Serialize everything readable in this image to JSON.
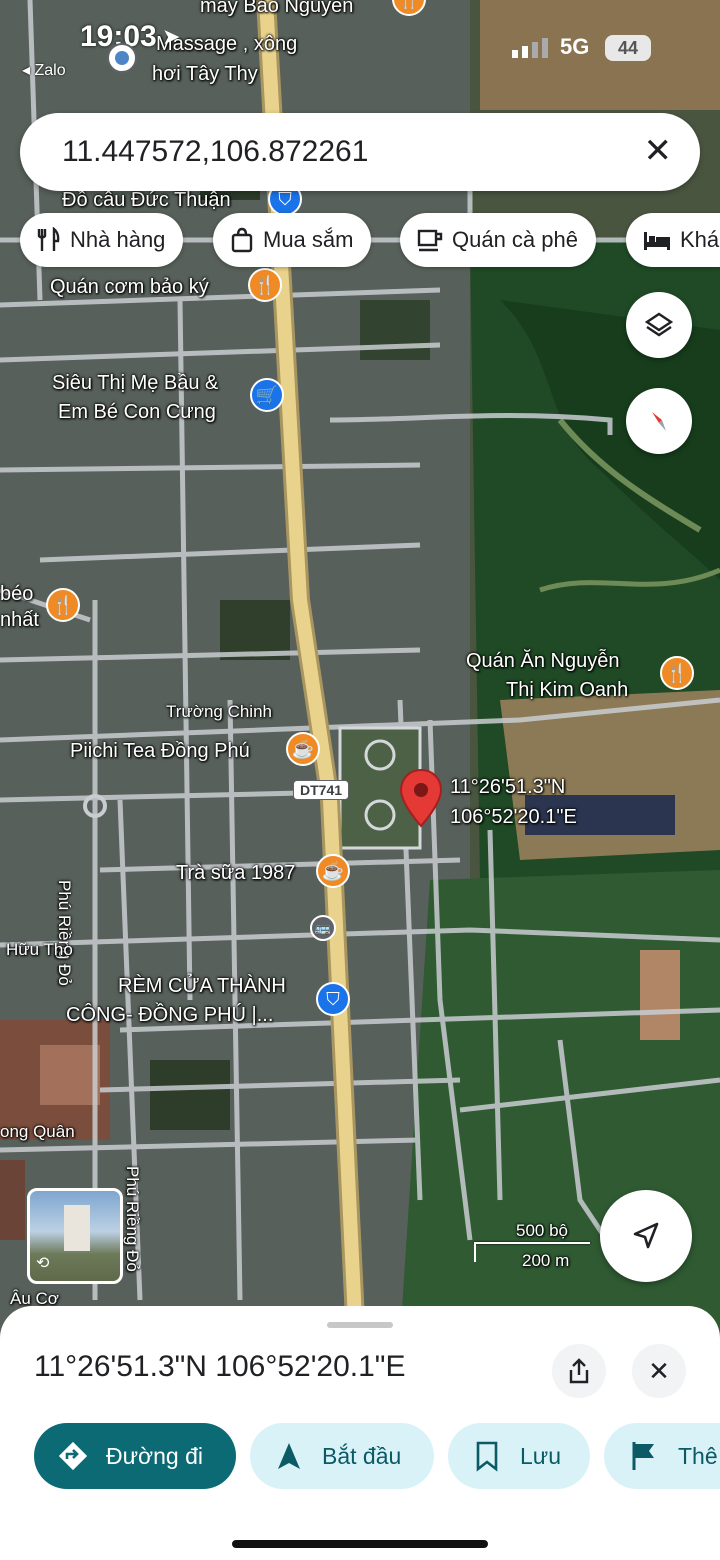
{
  "status_bar": {
    "time": "19:03",
    "back_app": "Zalo",
    "network": "5G",
    "battery": "44"
  },
  "search": {
    "value": "11.447572,106.872261"
  },
  "chips": [
    {
      "label": "Nhà hàng",
      "icon": "fork-knife-icon"
    },
    {
      "label": "Mua sắm",
      "icon": "shopping-bag-icon"
    },
    {
      "label": "Quán cà phê",
      "icon": "coffee-cup-icon"
    },
    {
      "label": "Khá",
      "icon": "bed-icon"
    }
  ],
  "map_labels": {
    "top_cut": "may Bảo Nguyên",
    "massage_l1": "Massage , xông",
    "massage_l2": "hơi Tây Thy",
    "do_cau": "Đồ câu Đức Thuận",
    "quan_com": "Quán cơm bảo ký",
    "sieu_thi_l1": "Siêu Thị Mẹ Bầu &",
    "sieu_thi_l2": "Em Bé Con Cưng",
    "beo_l1": "béo",
    "beo_l2": "nhất",
    "quan_an_l1": "Quán Ăn Nguyễn",
    "quan_an_l2": "Thị Kim Oanh",
    "truong_chinh": "Trường Chinh",
    "piichi": "Piichi Tea Đồng Phú",
    "dt741": "DT741",
    "pin_lat": "11°26'51.3\"N",
    "pin_lng": "106°52'20.1\"E",
    "tra_sua": "Trà sữa 1987",
    "phu_rieng_do_1": "Phú Riềng Đỏ",
    "huu_tho": "Hữu Thọ",
    "rem_cua_l1": "RÈM CỬA THÀNH",
    "rem_cua_l2": "CÔNG- ĐỒNG PHÚ |...",
    "cong_quan": "ong Quân",
    "phu_rieng_do_2": "Phú Riềng Đỏ",
    "au_co": "Âu Cơ",
    "scale_top": "500 bộ",
    "scale_bottom": "200 m"
  },
  "bottom_sheet": {
    "coords": "11°26'51.3\"N 106°52'20.1\"E",
    "actions": [
      {
        "label": "Đường đi",
        "icon": "directions-icon"
      },
      {
        "label": "Bắt đầu",
        "icon": "navigation-arrow-icon"
      },
      {
        "label": "Lưu",
        "icon": "bookmark-icon"
      },
      {
        "label": "Thê",
        "icon": "flag-icon"
      }
    ]
  },
  "colors": {
    "primary_button": "#0b6a73",
    "secondary_button": "#d8f2f7",
    "poi_orange": "#f08a24",
    "poi_blue": "#1a73e8",
    "pin_red": "#e53935",
    "main_road": "#e8d28c"
  }
}
